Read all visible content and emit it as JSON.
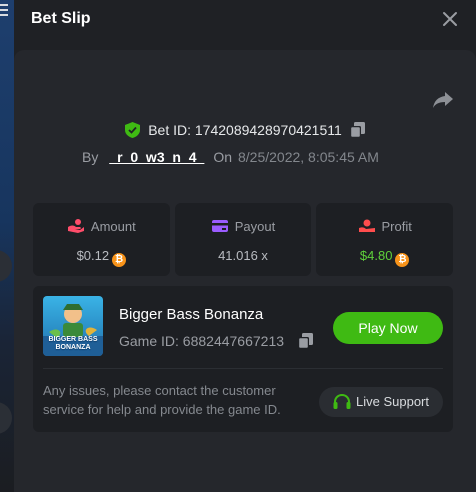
{
  "modal": {
    "title": "Bet Slip"
  },
  "bet": {
    "id_label": "Bet ID:",
    "id": "1742089428970421511",
    "by_label": "By",
    "user": "_r_0_w3_n_4_",
    "on_label": "On",
    "date": "8/25/2022, 8:05:45 AM"
  },
  "stats": [
    {
      "label": "Amount",
      "value": "$0.12",
      "icon": "amount-icon",
      "color": "#ff4d6a"
    },
    {
      "label": "Payout",
      "value": "41.016 x",
      "icon": "payout-icon",
      "color": "#9b5cff"
    },
    {
      "label": "Profit",
      "value": "$4.80",
      "icon": "profit-icon",
      "color": "#ff4d4d"
    }
  ],
  "game": {
    "name": "Bigger Bass Bonanza",
    "id_label": "Game ID:",
    "id": "6882447667213",
    "thumb_text": "BIGGER BASS BONANZA",
    "play_label": "Play Now"
  },
  "support": {
    "text": "Any issues, please contact the customer service for help and provide the game ID.",
    "button_label": "Live Support"
  },
  "colors": {
    "accent_green": "#3fba13",
    "profit_green": "#5fd13b",
    "coin": "#f7931a",
    "shield": "#3fba13"
  }
}
